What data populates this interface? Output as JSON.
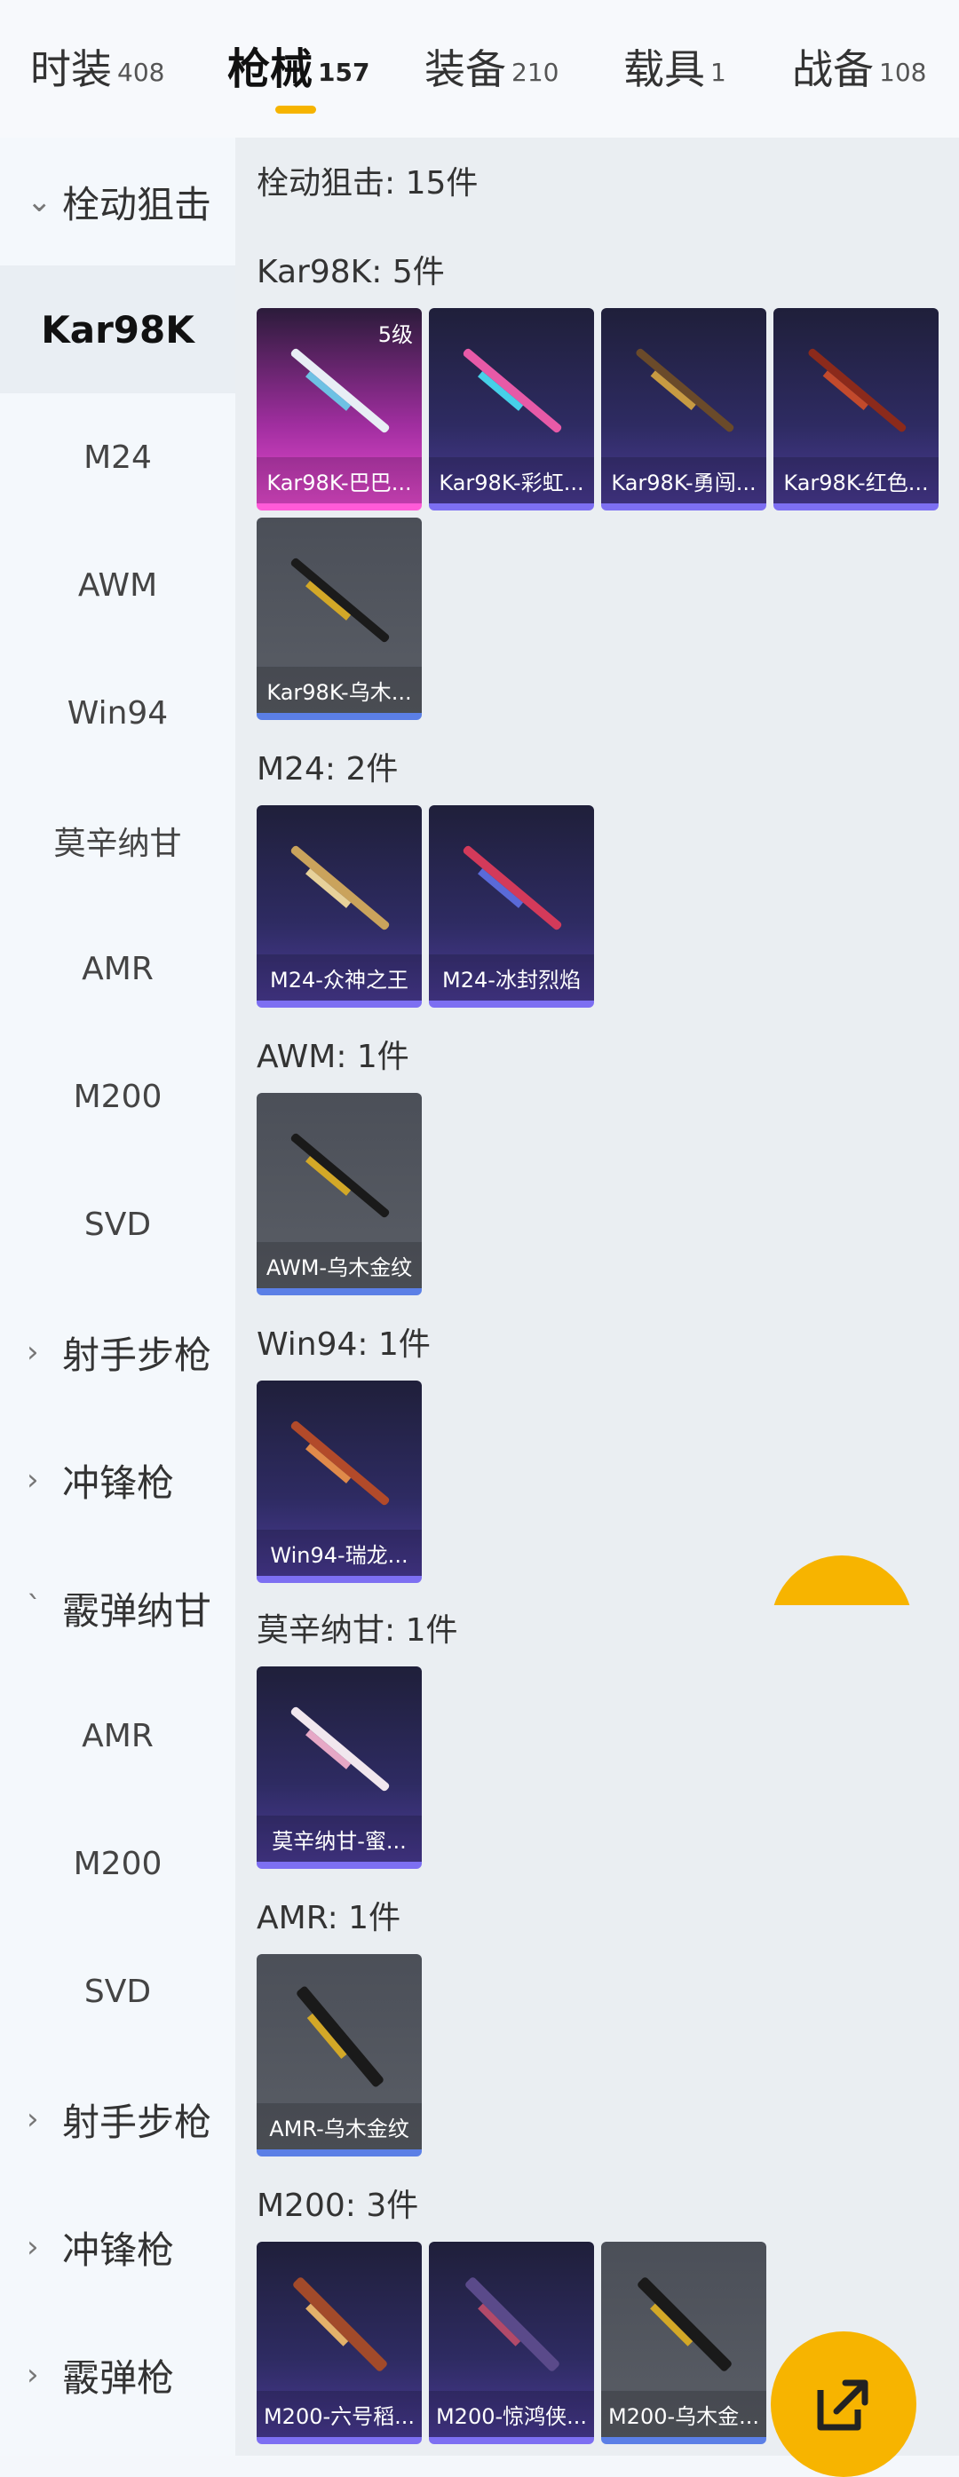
{
  "tabs": [
    {
      "label": "时装",
      "count": "408"
    },
    {
      "label": "枪械",
      "count": "157"
    },
    {
      "label": "装备",
      "count": "210"
    },
    {
      "label": "载具",
      "count": "1"
    },
    {
      "label": "战备",
      "count": "108"
    }
  ],
  "sidebar": {
    "items": [
      {
        "label": "栓动狙击",
        "type": "group",
        "chevron": "chevron-down-icon"
      },
      {
        "label": "Kar98K",
        "active": true
      },
      {
        "label": "M24"
      },
      {
        "label": "AWM"
      },
      {
        "label": "Win94"
      },
      {
        "label": "莫辛纳甘"
      },
      {
        "label": "AMR"
      },
      {
        "label": "M200"
      },
      {
        "label": "SVD"
      },
      {
        "label": "射手步枪",
        "type": "group",
        "chevron": "chevron-right-icon"
      },
      {
        "label": "冲锋枪",
        "type": "group",
        "chevron": "chevron-right-icon"
      },
      {
        "label": "霰弹纳甘",
        "type": "group"
      },
      {
        "label": "AMR"
      },
      {
        "label": "M200"
      },
      {
        "label": "SVD"
      },
      {
        "label": "射手步枪",
        "type": "group",
        "chevron": "chevron-right-icon"
      },
      {
        "label": "冲锋枪",
        "type": "group",
        "chevron": "chevron-right-icon"
      },
      {
        "label": "霰弹枪",
        "type": "group",
        "chevron": "chevron-right-icon"
      }
    ]
  },
  "main": {
    "title": "栓动狙击: 15件",
    "categories": [
      {
        "title": "Kar98K: 5件",
        "items": [
          {
            "label": "Kar98K-巴巴...",
            "level": "5级",
            "style": "pink"
          },
          {
            "label": "Kar98K-彩虹...",
            "style": "purple"
          },
          {
            "label": "Kar98K-勇闯...",
            "style": "purple"
          },
          {
            "label": "Kar98K-红色...",
            "style": "purple"
          },
          {
            "label": "Kar98K-乌木...",
            "style": "gray"
          }
        ]
      },
      {
        "title": "M24: 2件",
        "items": [
          {
            "label": "M24-众神之王",
            "style": "purple"
          },
          {
            "label": "M24-冰封烈焰",
            "style": "purple"
          }
        ]
      },
      {
        "title": "AWM: 1件",
        "items": [
          {
            "label": "AWM-乌木金纹",
            "style": "gray"
          }
        ]
      },
      {
        "title": "Win94: 1件",
        "items": [
          {
            "label": "Win94-瑞龙...",
            "style": "purple"
          }
        ]
      },
      {
        "title": "莫辛纳甘: 1件",
        "items": [
          {
            "label": "莫辛纳甘-蜜...",
            "style": "purple"
          }
        ]
      },
      {
        "title": "AMR: 1件",
        "items": [
          {
            "label": "AMR-乌木金纹",
            "style": "gray"
          }
        ]
      },
      {
        "title": "M200: 3件",
        "items": [
          {
            "label": "M200-六号稻...",
            "style": "purple"
          },
          {
            "label": "M200-惊鸿侠...",
            "style": "purple"
          },
          {
            "label": "M200-乌木金...",
            "style": "gray"
          }
        ]
      }
    ]
  },
  "colors": {
    "accent": "#f6b400",
    "sidebar_active": "#e9eef3",
    "content_bg": "#eaeef2"
  }
}
